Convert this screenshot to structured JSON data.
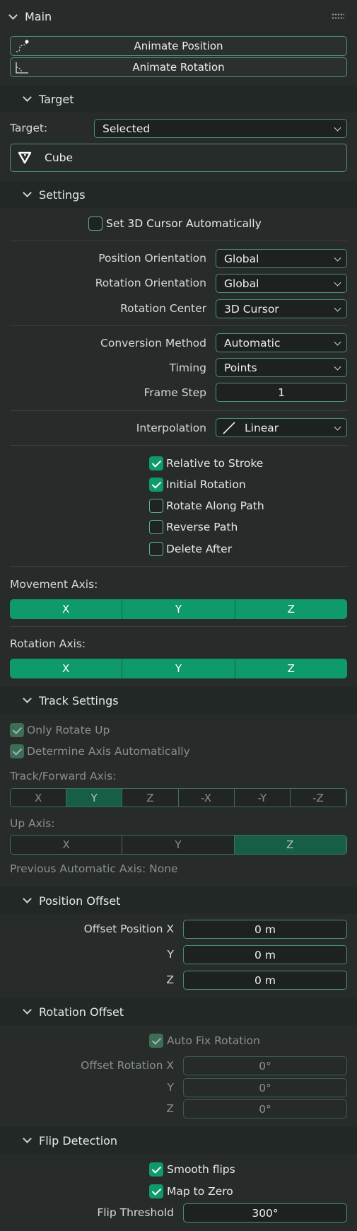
{
  "main": {
    "title": "Main"
  },
  "buttons": {
    "animate_position": "Animate Position",
    "animate_rotation": "Animate Rotation"
  },
  "target": {
    "header": "Target",
    "label": "Target:",
    "selected": "Selected",
    "object": "Cube"
  },
  "settings": {
    "header": "Settings",
    "set_cursor": "Set 3D Cursor Automatically",
    "position_orientation_label": "Position Orientation",
    "position_orientation": "Global",
    "rotation_orientation_label": "Rotation Orientation",
    "rotation_orientation": "Global",
    "rotation_center_label": "Rotation Center",
    "rotation_center": "3D Cursor",
    "conversion_method_label": "Conversion Method",
    "conversion_method": "Automatic",
    "timing_label": "Timing",
    "timing": "Points",
    "frame_step_label": "Frame Step",
    "frame_step": "1",
    "interpolation_label": "Interpolation",
    "interpolation": "Linear",
    "relative_to_stroke": "Relative to Stroke",
    "initial_rotation": "Initial Rotation",
    "rotate_along_path": "Rotate Along Path",
    "reverse_path": "Reverse Path",
    "delete_after": "Delete After",
    "movement_axis_label": "Movement Axis:",
    "movement_axis": [
      "X",
      "Y",
      "Z"
    ],
    "rotation_axis_label": "Rotation Axis:",
    "rotation_axis": [
      "X",
      "Y",
      "Z"
    ]
  },
  "track": {
    "header": "Track Settings",
    "only_rotate_up": "Only Rotate Up",
    "determine_axis": "Determine Axis Automatically",
    "forward_label": "Track/Forward Axis:",
    "forward_axis": [
      "X",
      "Y",
      "Z",
      "-X",
      "-Y",
      "-Z"
    ],
    "up_label": "Up Axis:",
    "up_axis": [
      "X",
      "Y",
      "Z"
    ],
    "previous": "Previous Automatic Axis: None"
  },
  "position_offset": {
    "header": "Position Offset",
    "x_label": "Offset Position X",
    "y_label": "Y",
    "z_label": "Z",
    "x": "0 m",
    "y": "0 m",
    "z": "0 m"
  },
  "rotation_offset": {
    "header": "Rotation Offset",
    "auto_fix": "Auto Fix Rotation",
    "x_label": "Offset Rotation X",
    "y_label": "Y",
    "z_label": "Z",
    "x": "0°",
    "y": "0°",
    "z": "0°"
  },
  "flip": {
    "header": "Flip Detection",
    "smooth": "Smooth flips",
    "map_zero": "Map to Zero",
    "threshold_label": "Flip Threshold",
    "threshold": "300°"
  }
}
